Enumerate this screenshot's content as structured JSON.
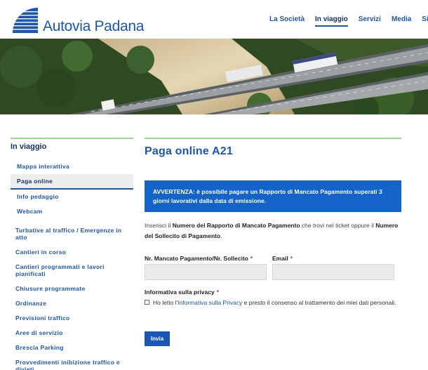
{
  "brand": {
    "name": "Autovia Padana",
    "color": "#1a56b5"
  },
  "nav": [
    {
      "label": "La Società"
    },
    {
      "label": "In viaggio"
    },
    {
      "label": "Servizi"
    },
    {
      "label": "Media"
    },
    {
      "label": "Sicure"
    }
  ],
  "sidebar": {
    "title": "In viaggio",
    "sub_items": [
      {
        "label": "Mappa interattiva"
      },
      {
        "label": "Paga online"
      },
      {
        "label": "Info pedaggio"
      },
      {
        "label": "Webcam"
      }
    ],
    "items": [
      {
        "label": "Turbative al traffico / Emergenze in atto"
      },
      {
        "label": "Cantieri in corso"
      },
      {
        "label": "Cantieri programmati e lavori pianificati"
      },
      {
        "label": "Chiusure programmate"
      },
      {
        "label": "Ordinanze"
      },
      {
        "label": "Previsioni traffico"
      },
      {
        "label": "Aree di servizio"
      },
      {
        "label": "Brescia Parking"
      },
      {
        "label": "Provvedimenti inibizione traffico e divieti"
      }
    ]
  },
  "main": {
    "title": "Paga online A21",
    "warning": "AVVERTENZA: è possibile pagare un Rapporto di Mancato Pagamento superati 3 giorni lavorativi dalla data di emissione.",
    "intro": {
      "part1": "Inserisci il ",
      "bold1": "Numero del Rapporto di Mancato Pagamento",
      "part2": " che trovi nel ticket oppure il ",
      "bold2": "Numero del Sollecito di Pagamento",
      "part3": "."
    },
    "form": {
      "number_label": "Nr. Mancato Pagamento/Nr. Sollecito",
      "email_label": "Email",
      "required_mark": "*",
      "number_value": "",
      "email_value": "",
      "privacy_label": "Informativa sulla privacy",
      "privacy_text1": "Ho letto l'",
      "privacy_link": "Informativa sulla Privacy",
      "privacy_text2": " e presto il consenso al trattamento dei miei dati personali.",
      "submit_label": "Invia"
    }
  }
}
